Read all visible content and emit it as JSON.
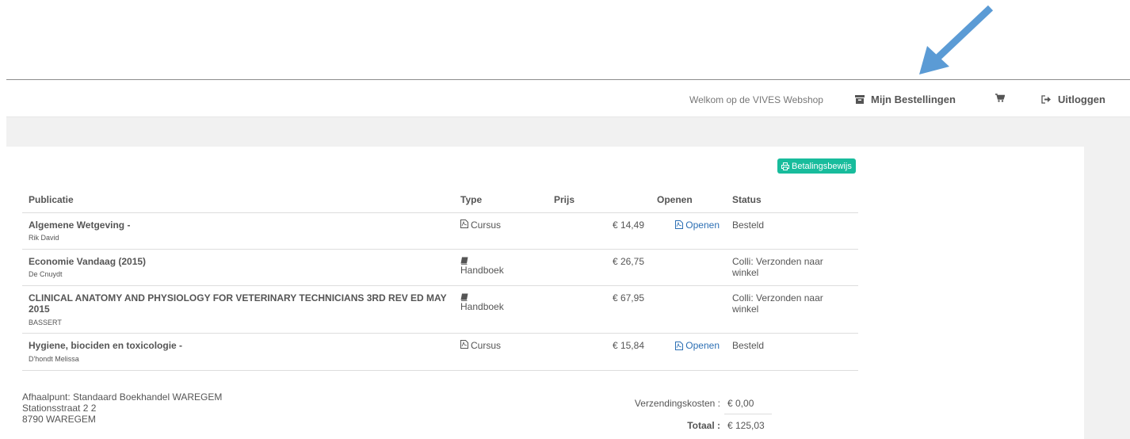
{
  "header": {
    "welcome": "Welkom op de VIVES Webshop",
    "orders_label": "Mijn Bestellingen",
    "logout_label": "Uitloggen",
    "orders_icon": "archive-icon",
    "cart_icon": "cart-icon",
    "logout_icon": "sign-out-icon"
  },
  "payment_button": {
    "label": "Betalingsbewijs",
    "icon": "print-icon",
    "color": "#18bc9c"
  },
  "table": {
    "headers": {
      "publication": "Publicatie",
      "type": "Type",
      "price": "Prijs",
      "open": "Openen",
      "status": "Status"
    },
    "rows": [
      {
        "title": "Algemene Wetgeving -",
        "author": "Rik David",
        "type": "Cursus",
        "type_icon": "pdf-icon",
        "price": "€ 14,49",
        "open": "Openen",
        "status": "Besteld"
      },
      {
        "title": "Economie Vandaag (2015)",
        "author": "De Cnuydt",
        "type": "Handboek",
        "type_icon": "book-icon",
        "price": "€ 26,75",
        "open": "",
        "status": "Colli: Verzonden naar winkel"
      },
      {
        "title": "CLINICAL ANATOMY AND PHYSIOLOGY FOR VETERINARY TECHNICIANS 3RD REV ED MAY 2015",
        "author": "BASSERT",
        "type": "Handboek",
        "type_icon": "book-icon",
        "price": "€ 67,95",
        "open": "",
        "status": "Colli: Verzonden naar winkel"
      },
      {
        "title": "Hygiene, biociden en toxicologie -",
        "author": "D'hondt Melissa",
        "type": "Cursus",
        "type_icon": "pdf-icon",
        "price": "€ 15,84",
        "open": "Openen",
        "status": "Besteld"
      }
    ]
  },
  "pickup": {
    "line1": "Afhaalpunt: Standaard Boekhandel WAREGEM",
    "line2": "Stationsstraat 2 2",
    "line3": "8790 WAREGEM"
  },
  "summary": {
    "shipping_label": "Verzendingskosten :",
    "shipping_value": "€ 0,00",
    "total_label": "Totaal :",
    "total_value": "€ 125,03"
  },
  "colors": {
    "link": "#2c6fb4",
    "accent": "#18bc9c",
    "arrow": "#5b9bd5",
    "band": "#f1f1f1"
  }
}
